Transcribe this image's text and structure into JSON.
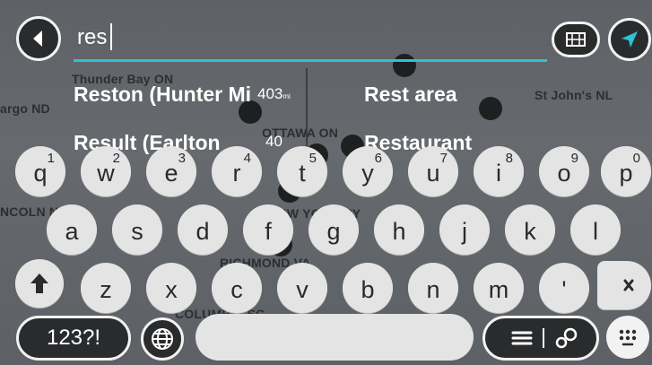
{
  "map": {
    "labels": [
      "Thunder Bay ON",
      "St John's NL",
      "OTTAWA ON",
      "NEW YORK NY",
      "RICHMOND VA",
      "COLUMBIA SC",
      "argo ND",
      "NCOLN NE"
    ]
  },
  "search": {
    "query": "res"
  },
  "suggestions": [
    {
      "name": "Reston (Hunter Mi",
      "distance": "403",
      "unit": "mi"
    },
    {
      "name": "Rest area"
    },
    {
      "name": "Result (Earlton",
      "distance": "40"
    },
    {
      "name": "Restaurant"
    }
  ],
  "keyboard": {
    "row1": [
      {
        "key": "q",
        "alt": "1"
      },
      {
        "key": "w",
        "alt": "2"
      },
      {
        "key": "e",
        "alt": "3"
      },
      {
        "key": "r",
        "alt": "4"
      },
      {
        "key": "t",
        "alt": "5"
      },
      {
        "key": "y",
        "alt": "6"
      },
      {
        "key": "u",
        "alt": "7"
      },
      {
        "key": "i",
        "alt": "8"
      },
      {
        "key": "o",
        "alt": "9"
      },
      {
        "key": "p",
        "alt": "0"
      }
    ],
    "row2": [
      "a",
      "s",
      "d",
      "f",
      "g",
      "h",
      "j",
      "k",
      "l"
    ],
    "row3": [
      "z",
      "x",
      "c",
      "v",
      "b",
      "n",
      "m",
      "'"
    ],
    "symbols_label": "123?!"
  },
  "colors": {
    "accent": "#2bc3d6",
    "key_bg": "#e4e4e4",
    "dark_button": "#2a2b2d"
  },
  "icons": [
    "back-arrow-icon",
    "map-view-icon",
    "navigate-arrow-icon",
    "shift-icon",
    "backspace-icon",
    "globe-icon",
    "list-view-icon",
    "search-on-map-icon",
    "keyboard-icon"
  ]
}
